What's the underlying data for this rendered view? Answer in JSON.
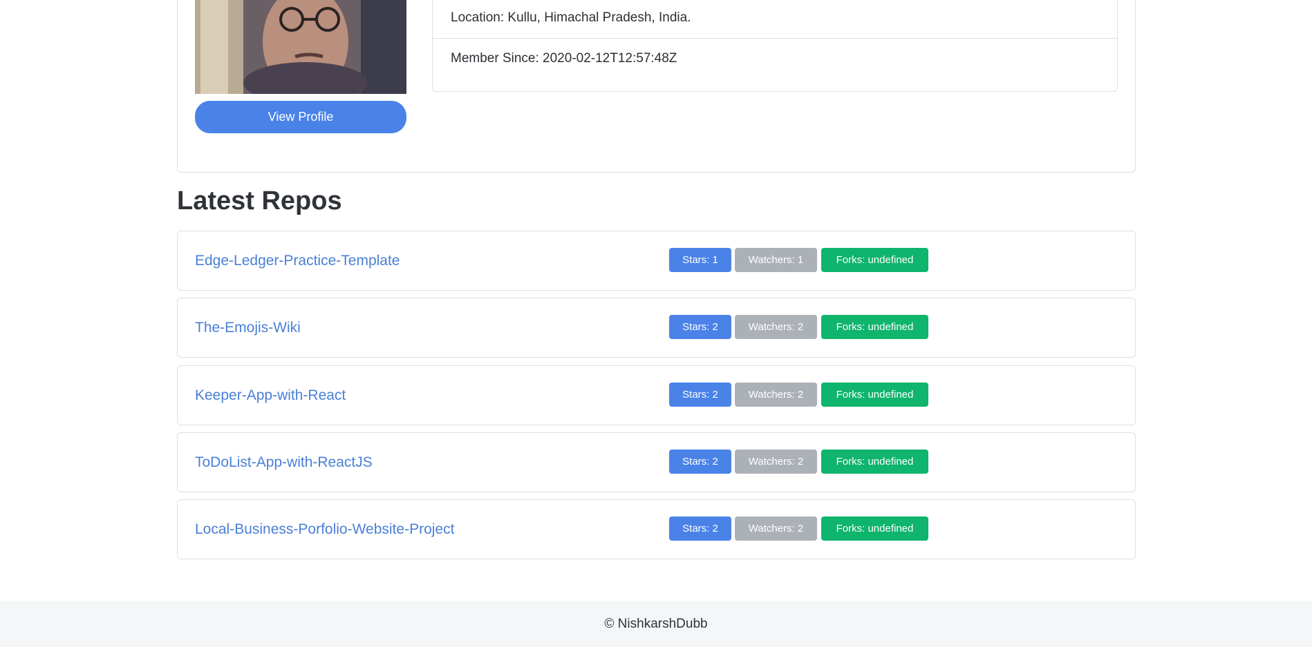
{
  "profile": {
    "view_profile_label": "View Profile",
    "location": "Location: Kullu, Himachal Pradesh, India.",
    "member_since": "Member Since: 2020-02-12T12:57:48Z"
  },
  "repos_section": {
    "title": "Latest Repos",
    "repos": [
      {
        "name": "Edge-Ledger-Practice-Template",
        "stars": "Stars: 1",
        "watchers": "Watchers: 1",
        "forks": "Forks: undefined"
      },
      {
        "name": "The-Emojis-Wiki",
        "stars": "Stars: 2",
        "watchers": "Watchers: 2",
        "forks": "Forks: undefined"
      },
      {
        "name": "Keeper-App-with-React",
        "stars": "Stars: 2",
        "watchers": "Watchers: 2",
        "forks": "Forks: undefined"
      },
      {
        "name": "ToDoList-App-with-ReactJS",
        "stars": "Stars: 2",
        "watchers": "Watchers: 2",
        "forks": "Forks: undefined"
      },
      {
        "name": "Local-Business-Porfolio-Website-Project",
        "stars": "Stars: 2",
        "watchers": "Watchers: 2",
        "forks": "Forks: undefined"
      }
    ]
  },
  "footer": {
    "text": "© NishkarshDubb"
  },
  "colors": {
    "primary": "#4a82e8",
    "secondary": "#acb1b8",
    "success": "#0fb46d",
    "link": "#4a7fd6",
    "footer_bg": "#f5f6f7"
  }
}
